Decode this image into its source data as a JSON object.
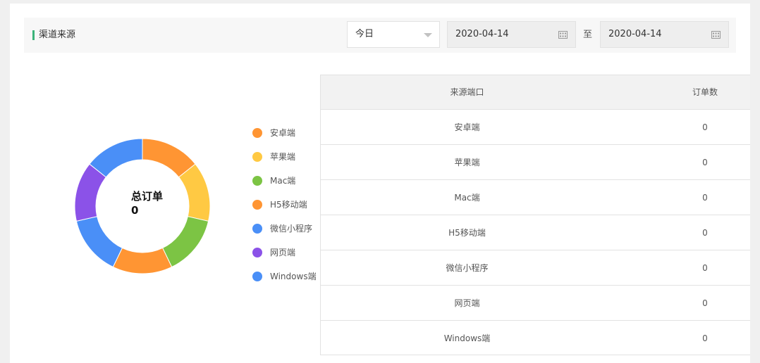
{
  "header": {
    "title": "渠道来源",
    "period": "今日",
    "date_start": "2020-04-14",
    "date_separator": "至",
    "date_end": "2020-04-14"
  },
  "summary": {
    "label": "总订单",
    "value": "0"
  },
  "chart_data": {
    "type": "pie",
    "title": "",
    "categories": [
      "安卓端",
      "苹果端",
      "Mac端",
      "H5移动端",
      "微信小程序",
      "网页端",
      "Windows端"
    ],
    "values": [
      0,
      0,
      0,
      0,
      0,
      0,
      0
    ],
    "colors": [
      "#ff9533",
      "#ffc943",
      "#7cc444",
      "#ff9533",
      "#4a8ff7",
      "#8b52e8",
      "#4a8ff7"
    ],
    "legend_position": "right",
    "donut": true
  },
  "table": {
    "columns": [
      "来源端口",
      "订单数"
    ],
    "rows": [
      [
        "安卓端",
        "0"
      ],
      [
        "苹果端",
        "0"
      ],
      [
        "Mac端",
        "0"
      ],
      [
        "H5移动端",
        "0"
      ],
      [
        "微信小程序",
        "0"
      ],
      [
        "网页端",
        "0"
      ],
      [
        "Windows端",
        "0"
      ]
    ]
  }
}
